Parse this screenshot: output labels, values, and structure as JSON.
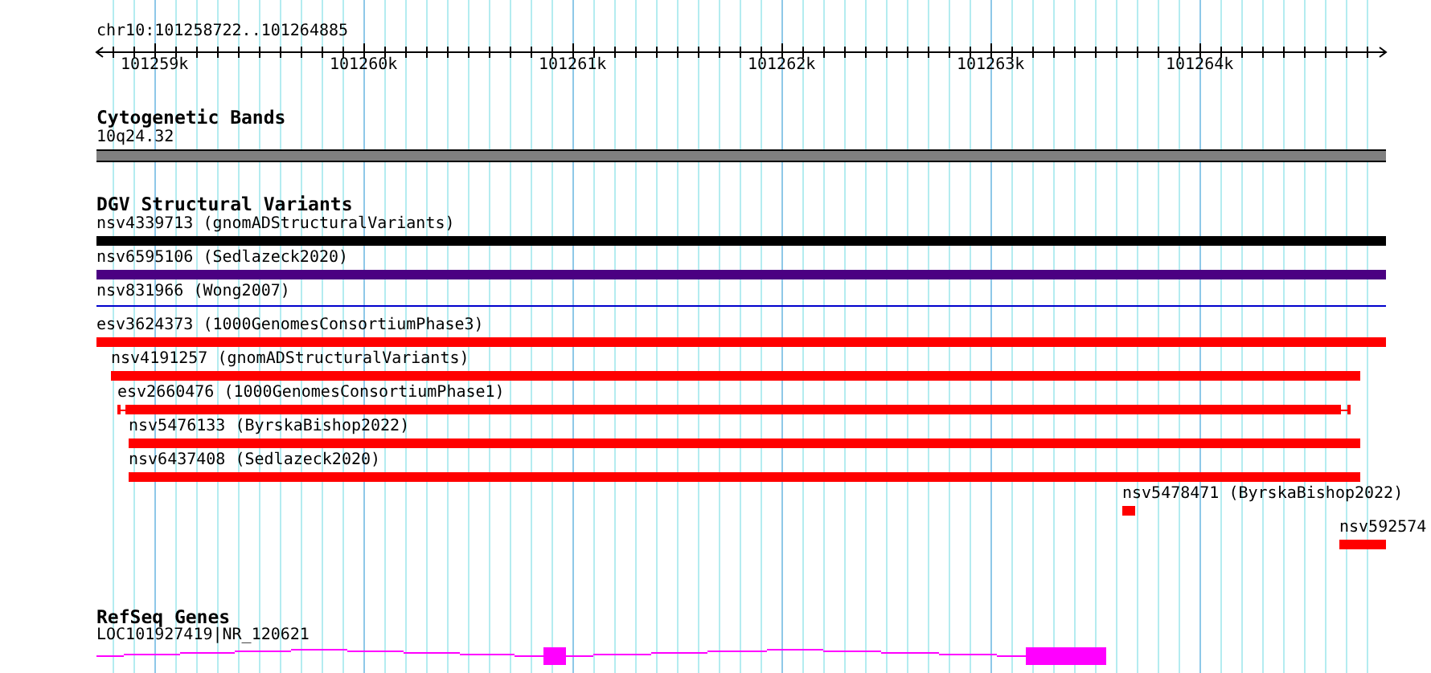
{
  "location": "chr10:101258722..101264885",
  "ruler_ticks": [
    "101259k",
    "101260k",
    "101261k",
    "101262k",
    "101263k",
    "101264k"
  ],
  "tracks": [
    {
      "title": "Cytogenetic Bands",
      "kind": "bands",
      "features": [
        {
          "label": "10q24.32"
        }
      ]
    },
    {
      "title": "DGV Structural Variants",
      "kind": "variants",
      "features": [
        {
          "label": "nsv4339713 (gnomADStructuralVariants)",
          "kind": "bar",
          "color": "#000000"
        },
        {
          "label": "nsv6595106 (Sedlazeck2020)",
          "kind": "bar",
          "color": "#4b0082"
        },
        {
          "label": "nsv831966 (Wong2007)",
          "kind": "line",
          "color": "#0000cc"
        },
        {
          "label": "esv3624373 (1000GenomesConsortiumPhase3)",
          "kind": "bar",
          "color": "#ff0000"
        },
        {
          "label": "nsv4191257 (gnomADStructuralVariants)",
          "kind": "bar",
          "color": "#ff0000"
        },
        {
          "label": "esv2660476 (1000GenomesConsortiumPhase1)",
          "kind": "capped",
          "color": "#ff0000"
        },
        {
          "label": "nsv5476133 (ByrskaBishop2022)",
          "kind": "bar",
          "color": "#ff0000"
        },
        {
          "label": "nsv6437408 (Sedlazeck2020)",
          "kind": "bar",
          "color": "#ff0000"
        },
        {
          "label": "nsv5478471 (ByrskaBishop2022)",
          "kind": "bar",
          "color": "#ff0000"
        },
        {
          "label": "nsv592574",
          "kind": "bar",
          "color": "#ff0000"
        }
      ]
    },
    {
      "title": "RefSeq Genes",
      "kind": "genes",
      "features": [
        {
          "label": "LOC101927419|NR_120621"
        }
      ]
    }
  ]
}
